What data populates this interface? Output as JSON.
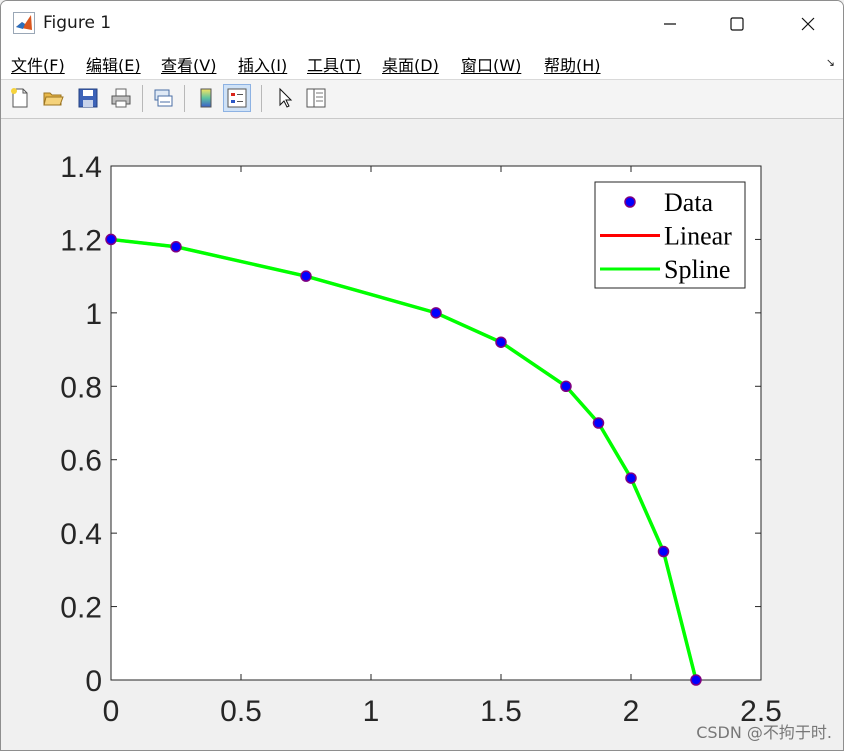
{
  "window": {
    "title": "Figure 1",
    "icon": "matlab-logo-icon",
    "controls": [
      "minimize-icon",
      "maximize-icon",
      "close-icon"
    ]
  },
  "menu": {
    "items": [
      "文件(F)",
      "编辑(E)",
      "查看(V)",
      "插入(I)",
      "工具(T)",
      "桌面(D)",
      "窗口(W)",
      "帮助(H)"
    ],
    "corner_icon": "dock-arrow-icon"
  },
  "toolbar": {
    "icons": [
      "new-figure-icon",
      "open-file-icon",
      "save-icon",
      "print-icon",
      "link-plot-icon",
      "colorbar-icon",
      "legend-icon",
      "pointer-icon",
      "property-editor-icon"
    ],
    "active": "legend-icon"
  },
  "chart_data": {
    "type": "line",
    "title": "",
    "xlabel": "",
    "ylabel": "",
    "xlim": [
      0,
      2.5
    ],
    "ylim": [
      0,
      1.4
    ],
    "xticks": [
      "0",
      "0.5",
      "1",
      "1.5",
      "2",
      "2.5"
    ],
    "yticks": [
      "0",
      "0.2",
      "0.4",
      "0.6",
      "0.8",
      "1",
      "1.2",
      "1.4"
    ],
    "x": [
      0,
      0.25,
      0.75,
      1.25,
      1.5,
      1.75,
      1.875,
      2,
      2.125,
      2.25
    ],
    "series": [
      {
        "name": "Data",
        "style": "markers",
        "color": "#0000ff",
        "edge": "#800080",
        "values": [
          1.2,
          1.18,
          1.1,
          1.0,
          0.92,
          0.8,
          0.7,
          0.55,
          0.35,
          0
        ]
      },
      {
        "name": "Linear",
        "style": "line",
        "color": "#ff0000",
        "values": [
          1.2,
          1.18,
          1.1,
          1.0,
          0.92,
          0.8,
          0.7,
          0.55,
          0.35,
          0
        ]
      },
      {
        "name": "Spline",
        "style": "line",
        "color": "#00ff00",
        "values": [
          1.2,
          1.18,
          1.1,
          1.0,
          0.92,
          0.8,
          0.7,
          0.55,
          0.35,
          0
        ]
      }
    ],
    "legend_position": "top-right",
    "grid": false
  },
  "watermark": "CSDN @不拘于时."
}
